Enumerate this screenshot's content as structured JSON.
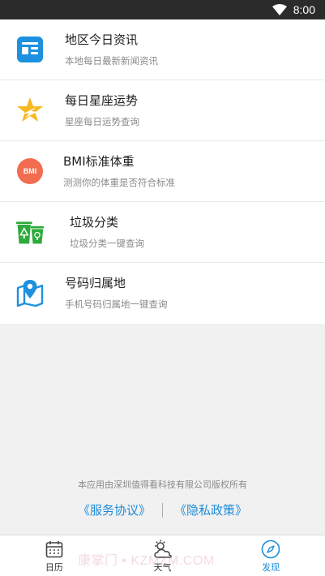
{
  "status_bar": {
    "time": "8:00",
    "wifi_icon": "wifi-icon"
  },
  "list": {
    "items": [
      {
        "title": "地区今日资讯",
        "subtitle": "本地每日最新新闻资讯",
        "icon": "news-icon",
        "color": "#1e90e0"
      },
      {
        "title": "每日星座运势",
        "subtitle": "星座每日运势查询",
        "icon": "star-icon",
        "color": "#f5b921"
      },
      {
        "title": "BMI标准体重",
        "subtitle": "测测你的体重是否符合标准",
        "icon": "bmi-icon",
        "icon_text": "BMI",
        "color": "#f26c4f"
      },
      {
        "title": "垃圾分类",
        "subtitle": "垃圾分类一键查询",
        "icon": "trash-bins-icon",
        "color": "#2eaa3c"
      },
      {
        "title": "号码归属地",
        "subtitle": "手机号码归属地一键查询",
        "icon": "map-pin-icon",
        "color": "#1e90e0"
      }
    ]
  },
  "footer": {
    "copyright": "本应用由深圳值得看科技有限公司版权所有",
    "service_link": "《服务协议》",
    "privacy_link": "《隐私政策》"
  },
  "tabbar": {
    "tabs": [
      {
        "label": "日历",
        "icon": "calendar-icon",
        "active": false
      },
      {
        "label": "天气",
        "icon": "weather-icon",
        "active": false
      },
      {
        "label": "发现",
        "icon": "compass-icon",
        "active": true
      }
    ]
  },
  "watermark": "康掌门 • KZMZM.COM",
  "colors": {
    "accent": "#1e8cd8",
    "status_bar": "#2b2b2b",
    "background": "#f1f1f1"
  }
}
